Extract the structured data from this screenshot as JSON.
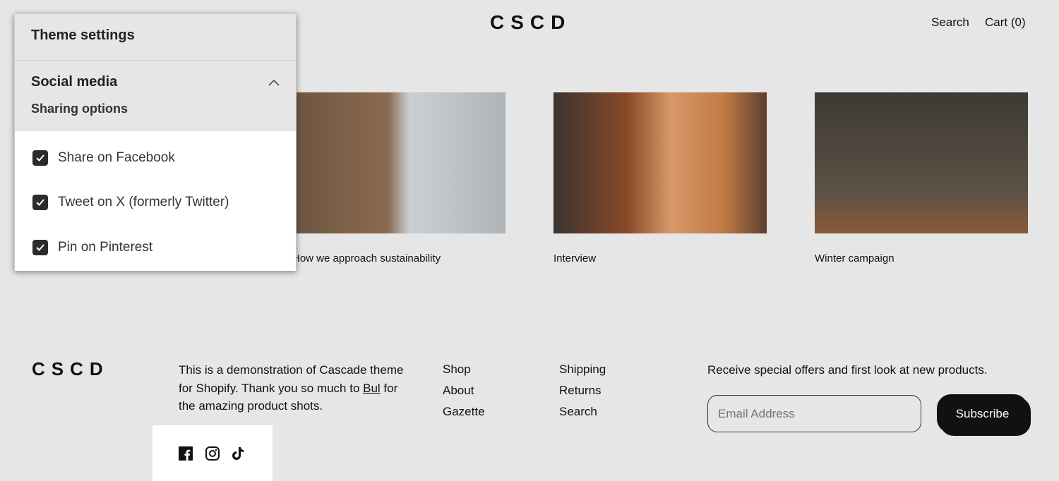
{
  "header": {
    "logo": "CSCD",
    "search": "Search",
    "cart": "Cart (0)"
  },
  "articles": [
    {
      "caption": "How we approach sustainability",
      "colors": [
        "#6d5540",
        "#c9cfd3"
      ]
    },
    {
      "caption": "Interview",
      "colors": [
        "#8a4a28",
        "#c07a44"
      ]
    },
    {
      "caption": "Winter campaign",
      "colors": [
        "#3e3a33",
        "#8a5a38"
      ]
    }
  ],
  "panel": {
    "title": "Theme settings",
    "section": "Social media",
    "subsection": "Sharing options",
    "options": [
      {
        "label": "Share on Facebook",
        "checked": true
      },
      {
        "label": "Tweet on X (formerly Twitter)",
        "checked": true
      },
      {
        "label": "Pin on Pinterest",
        "checked": true
      }
    ]
  },
  "footer": {
    "logo": "CSCD",
    "text_before": "This is a demonstration of Cascade theme for Shopify. Thank you so much to ",
    "link": "Bul",
    "text_after": " for the amazing product shots.",
    "nav1": [
      "Shop",
      "About",
      "Gazette"
    ],
    "nav2": [
      "Shipping",
      "Returns",
      "Search"
    ],
    "newsletter": "Receive special offers and first look at new products.",
    "email_placeholder": "Email Address",
    "subscribe": "Subscribe",
    "social": [
      "facebook-icon",
      "instagram-icon",
      "tiktok-icon"
    ]
  }
}
